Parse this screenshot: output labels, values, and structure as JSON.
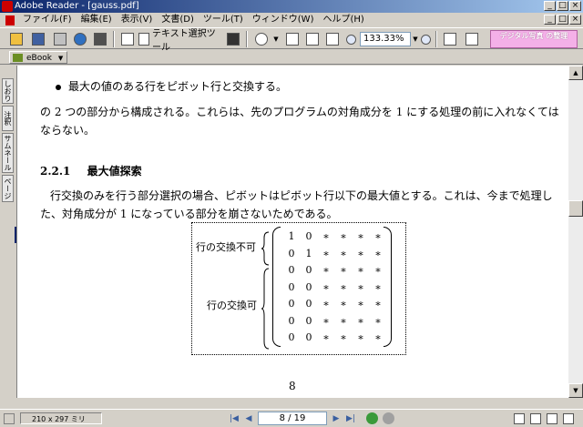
{
  "window": {
    "title": "Adobe Reader - [gauss.pdf]",
    "controls": [
      "_",
      "□",
      "×"
    ]
  },
  "menu": {
    "items": [
      "ファイル(F)",
      "編集(E)",
      "表示(V)",
      "文書(D)",
      "ツール(T)",
      "ウィンドウ(W)",
      "ヘルプ(H)"
    ]
  },
  "toolbar": {
    "text_select_label": "テキスト選択ツール",
    "zoom_value": "133.33%",
    "promo_label": "デジタル写真 の整理"
  },
  "toolbar2": {
    "ebook_label": "eBook"
  },
  "side_tabs": [
    "しおり",
    "注釈",
    "サムネール",
    "ページ"
  ],
  "document": {
    "bullet_text": "最大の値のある行をピボット行と交換する。",
    "para1_line1": "の 2 つの部分から構成される。これらは、先のプログラムの対角成分を 1 にする処理の前に入れなくては",
    "para1_line2": "ならない。",
    "section_number": "2.2.1",
    "section_title": "最大値探索",
    "para2_line1": "行交換のみを行う部分選択の場合、ピボットはピボット行以下の最大値とする。これは、今まで処理し",
    "para2_line2": "た、対角成分が 1 になっている部分を崩さないためである。",
    "label_no_swap": "行の交換不可",
    "label_swap": "行の交換可",
    "matrix": [
      [
        "1",
        "0",
        "∗",
        "∗",
        "∗",
        "∗"
      ],
      [
        "0",
        "1",
        "∗",
        "∗",
        "∗",
        "∗"
      ],
      [
        "0",
        "0",
        "∗",
        "∗",
        "∗",
        "∗"
      ],
      [
        "0",
        "0",
        "∗",
        "∗",
        "∗",
        "∗"
      ],
      [
        "0",
        "0",
        "∗",
        "∗",
        "∗",
        "∗"
      ],
      [
        "0",
        "0",
        "∗",
        "∗",
        "∗",
        "∗"
      ],
      [
        "0",
        "0",
        "∗",
        "∗",
        "∗",
        "∗"
      ]
    ],
    "page_number": "8"
  },
  "status": {
    "page_size": "210 x 297 ミリ",
    "page_indicator": "8 / 19",
    "nav": [
      "|◀",
      "◀",
      "▶",
      "▶|"
    ]
  }
}
